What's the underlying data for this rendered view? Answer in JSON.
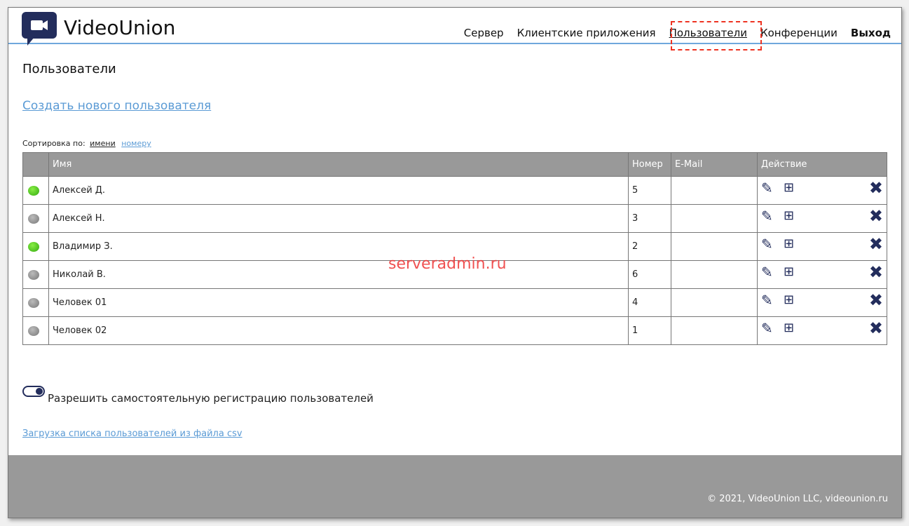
{
  "brand": "VideoUnion",
  "nav": [
    "Сервер",
    "Клиентские приложения",
    "Пользователи",
    "Конференции",
    "Выход"
  ],
  "page_title": "Пользователи",
  "create_link": "Создать нового пользователя",
  "sort": {
    "label": "Сортировка по:",
    "by_name": "имени",
    "by_number": "номеру"
  },
  "table": {
    "headers": [
      "",
      "Имя",
      "Номер",
      "E-Mail",
      "Действие"
    ],
    "rows": [
      {
        "name": "Алексей Д.",
        "number": "5",
        "email": "",
        "online": true
      },
      {
        "name": "Алексей Н.",
        "number": "3",
        "email": "",
        "online": false
      },
      {
        "name": "Владимир З.",
        "number": "2",
        "email": "",
        "online": true
      },
      {
        "name": "Николай В.",
        "number": "6",
        "email": "",
        "online": false
      },
      {
        "name": "Человек 01",
        "number": "4",
        "email": "",
        "online": false
      },
      {
        "name": "Человек 02",
        "number": "1",
        "email": "",
        "online": false
      }
    ]
  },
  "self_registration": {
    "label": "Разрешить самостоятельную регистрацию пользователей",
    "enabled": true
  },
  "csv_link": "Загрузка списка пользователей из файла csv",
  "footer": "© 2021, VideoUnion LLC, videounion.ru",
  "watermark": "serveradmin.ru"
}
